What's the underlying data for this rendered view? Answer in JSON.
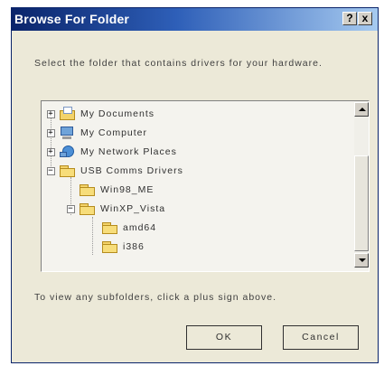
{
  "window": {
    "title": "Browse For Folder",
    "help_label": "?",
    "close_label": "x"
  },
  "instruction": "Select the folder that contains drivers for your hardware.",
  "tree": {
    "items": [
      {
        "label": "My Documents",
        "expander": "+",
        "icon": "my-documents-icon"
      },
      {
        "label": "My Computer",
        "expander": "+",
        "icon": "my-computer-icon"
      },
      {
        "label": "My Network Places",
        "expander": "+",
        "icon": "network-places-icon"
      },
      {
        "label": "USB Comms Drivers",
        "expander": "−",
        "icon": "folder-icon"
      },
      {
        "label": "Win98_ME",
        "expander": "",
        "icon": "folder-icon"
      },
      {
        "label": "WinXP_Vista",
        "expander": "−",
        "icon": "folder-open-icon"
      },
      {
        "label": "amd64",
        "expander": "",
        "icon": "folder-icon"
      },
      {
        "label": "i386",
        "expander": "",
        "icon": "folder-icon"
      }
    ]
  },
  "hint": "To view any subfolders, click a plus sign above.",
  "buttons": {
    "ok": "OK",
    "cancel": "Cancel"
  },
  "colors": {
    "dialog_bg": "#ece9d8",
    "titlebar": "#0a246a",
    "folder": "#f7dd7a"
  }
}
